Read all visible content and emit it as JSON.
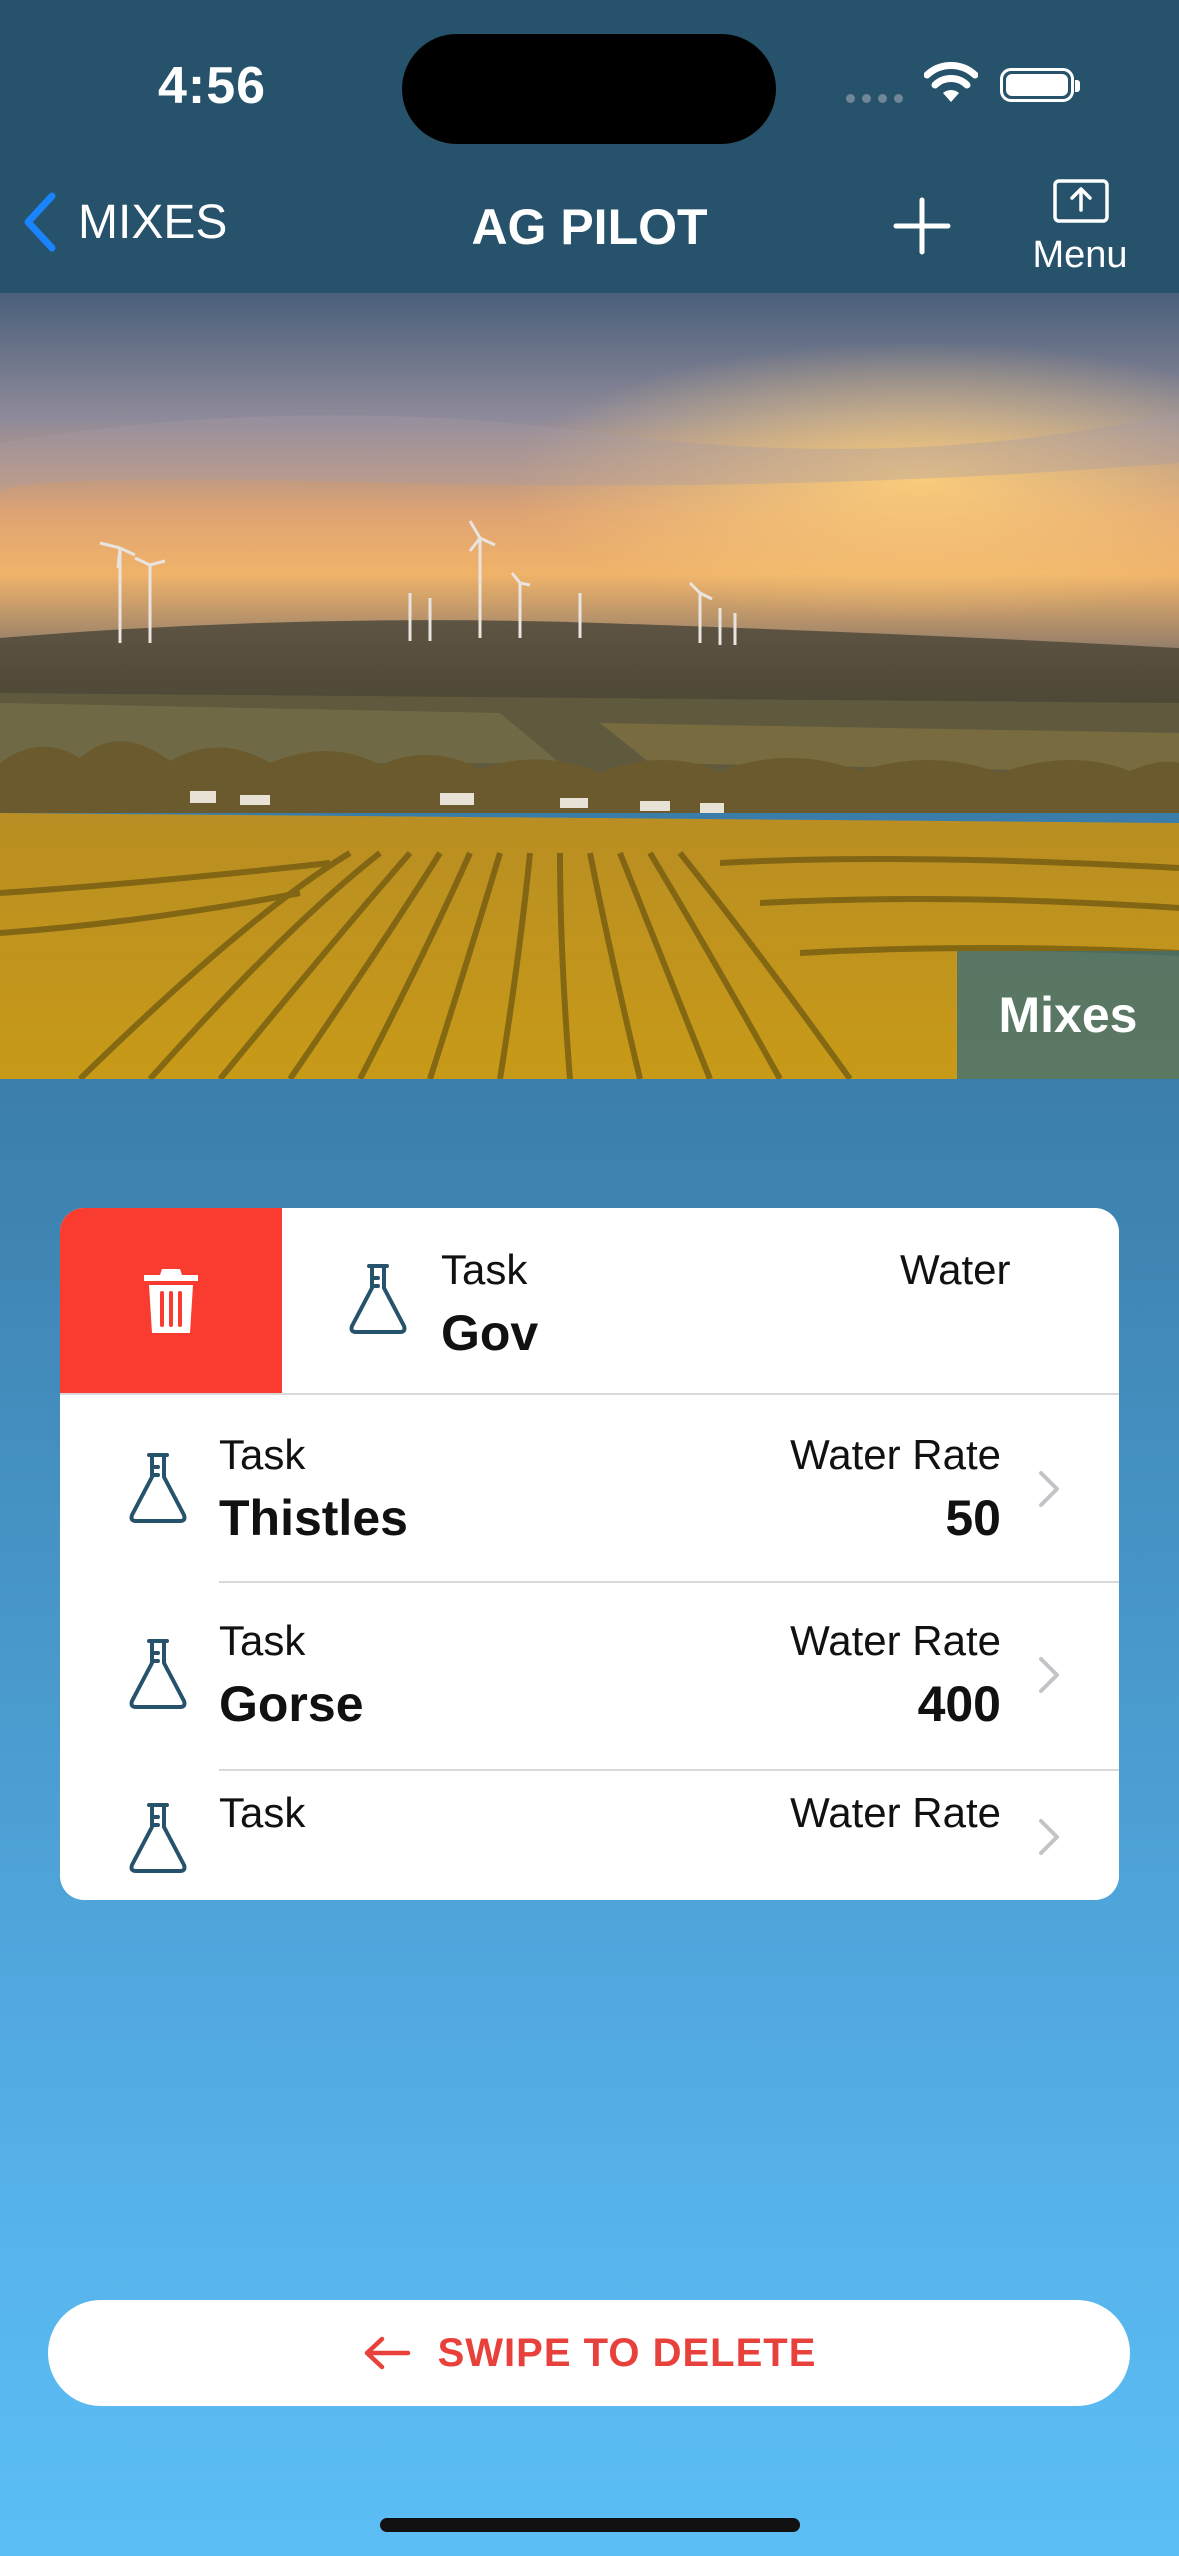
{
  "status_bar": {
    "time": "4:56"
  },
  "nav": {
    "back_label": "MIXES",
    "title": "AG PILOT",
    "menu_label": "Menu"
  },
  "hero": {
    "badge": "Mixes"
  },
  "list": {
    "rows": [
      {
        "task_label": "Task",
        "task_name": "Gov",
        "rate_label": "Water",
        "rate_value": "",
        "swiped": true
      },
      {
        "task_label": "Task",
        "task_name": "Thistles",
        "rate_label": "Water Rate",
        "rate_value": "50"
      },
      {
        "task_label": "Task",
        "task_name": "Gorse",
        "rate_label": "Water Rate",
        "rate_value": "400"
      },
      {
        "task_label": "Task",
        "task_name": "",
        "rate_label": "Water Rate",
        "rate_value": ""
      }
    ]
  },
  "swipe_hint": {
    "label": "SWIPE TO DELETE"
  },
  "icons": {
    "back": "chevron-left-icon",
    "add": "plus-icon",
    "menu": "share-tray-icon",
    "row": "flask-icon",
    "delete": "trash-icon",
    "disclosure": "chevron-right-icon",
    "swipe": "arrow-left-icon"
  },
  "colors": {
    "nav_bg": "#27526b",
    "accent_blue": "#1a84ff",
    "delete_red": "#fa3b30",
    "flask_stroke": "#27526b"
  }
}
